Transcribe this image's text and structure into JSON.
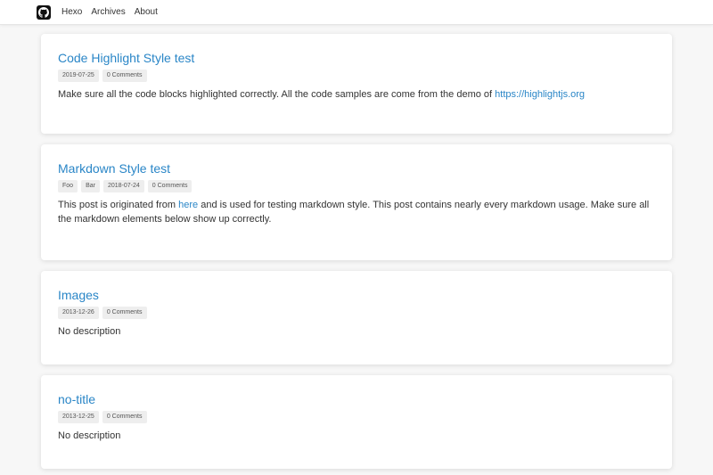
{
  "nav": {
    "items": [
      "Hexo",
      "Archives",
      "About"
    ]
  },
  "posts": [
    {
      "title": "Code Highlight Style test",
      "tags": [],
      "date": "2019-07-25",
      "comments": "0 Comments",
      "excerpt_before": "Make sure all the code blocks highlighted correctly. All the code samples are come from the demo of ",
      "excerpt_link": "https://highlightjs.org",
      "excerpt_after": ""
    },
    {
      "title": "Markdown Style test",
      "tags": [
        "Foo",
        "Bar"
      ],
      "date": "2018-07-24",
      "comments": "0 Comments",
      "excerpt_before": "This post is originated from ",
      "excerpt_link": "here",
      "excerpt_after": " and is used for testing markdown style. This post contains nearly every markdown usage. Make sure all the markdown elements below show up correctly."
    },
    {
      "title": "Images",
      "tags": [],
      "date": "2013-12-26",
      "comments": "0 Comments",
      "excerpt": "No description"
    },
    {
      "title": "no-title",
      "tags": [],
      "date": "2013-12-25",
      "comments": "0 Comments",
      "excerpt": "No description"
    }
  ],
  "colors": {
    "link": "#2a86c7",
    "background": "#f7f7f7",
    "tag_bg": "#eeeeee"
  },
  "icons": {
    "logo": "github-logo-icon"
  }
}
